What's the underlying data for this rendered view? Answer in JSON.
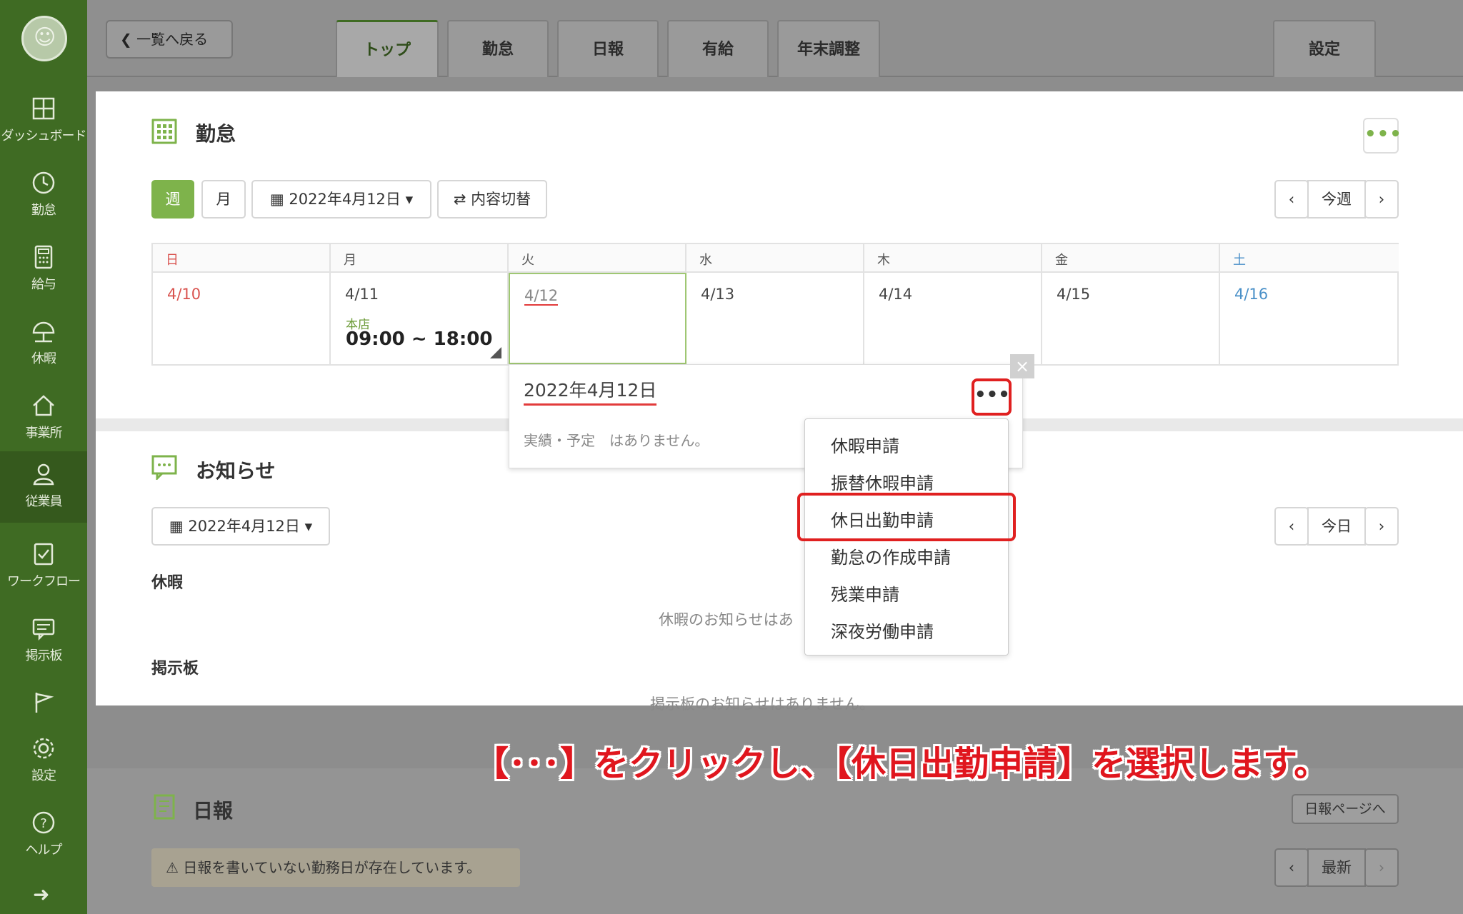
{
  "sidebar": {
    "items": [
      {
        "label": "ダッシュボード",
        "icon": "dashboard-icon"
      },
      {
        "label": "勤怠",
        "icon": "clock-icon"
      },
      {
        "label": "給与",
        "icon": "calculator-icon"
      },
      {
        "label": "休暇",
        "icon": "umbrella-icon"
      },
      {
        "label": "事業所",
        "icon": "home-icon"
      },
      {
        "label": "従業員",
        "icon": "user-icon"
      },
      {
        "label": "ワークフロー",
        "icon": "checklist-icon"
      },
      {
        "label": "掲示板",
        "icon": "chat-icon"
      },
      {
        "label": "",
        "icon": "flag-icon"
      },
      {
        "label": "設定",
        "icon": "gear-icon"
      },
      {
        "label": "ヘルプ",
        "icon": "help-icon"
      }
    ]
  },
  "topbar": {
    "back_label": "一覧へ戻る",
    "tabs": [
      "トップ",
      "勤怠",
      "日報",
      "有給",
      "年末調整"
    ],
    "settings_tab": "設定"
  },
  "attendance": {
    "title": "勤怠",
    "view_week": "週",
    "view_month": "月",
    "date_label": "2022年4月12日",
    "toggle_label": "内容切替",
    "this_week": "今週",
    "days": [
      {
        "head": "日",
        "date": "4/10"
      },
      {
        "head": "月",
        "date": "4/11"
      },
      {
        "head": "火",
        "date": "4/12"
      },
      {
        "head": "水",
        "date": "4/13"
      },
      {
        "head": "木",
        "date": "4/14"
      },
      {
        "head": "金",
        "date": "4/15"
      },
      {
        "head": "土",
        "date": "4/16"
      }
    ],
    "shift_place": "本店",
    "shift_time": "09:00 ~ 18:00"
  },
  "popup": {
    "date": "2022年4月12日",
    "empty": "実績・予定　はありません。",
    "menu": [
      "休暇申請",
      "振替休暇申請",
      "休日出勤申請",
      "勤怠の作成申請",
      "残業申請",
      "深夜労働申請"
    ]
  },
  "notice": {
    "title": "お知らせ",
    "date_label": "2022年4月12日",
    "today": "今日",
    "vacation_label": "休暇",
    "vacation_empty": "休暇のお知らせはあ",
    "board_label": "掲示板",
    "board_empty": "掲示板のお知らせはありません。"
  },
  "daily": {
    "title": "日報",
    "page_link": "日報ページへ",
    "alert": "日報を書いていない勤務日が存在しています。",
    "latest": "最新"
  },
  "annotation": "【･･･】をクリックし、【休日出勤申請】を選択します。",
  "colors": {
    "accent": "#7eb34b",
    "sidebar": "#3f6b23",
    "highlight": "#e02020"
  }
}
